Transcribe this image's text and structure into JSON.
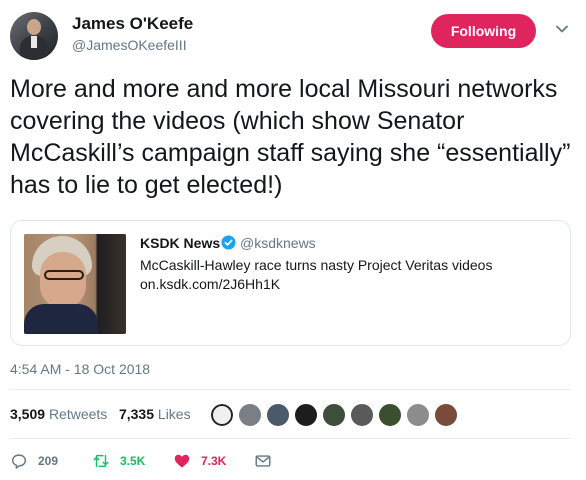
{
  "author": {
    "name": "James O'Keefe",
    "handle": "@JamesOKeefeIII",
    "follow_label": "Following"
  },
  "tweet": {
    "text": "More and more and more local Missouri networks covering the videos (which show Senator McCaskill’s campaign staff saying she “essentially” has to lie to get elected!)",
    "timestamp": "4:54 AM - 18 Oct 2018"
  },
  "card": {
    "source_name": "KSDK News",
    "source_handle": "@ksdknews",
    "title": "McCaskill-Hawley race turns nasty Project Veritas videos",
    "link": "on.ksdk.com/2J6Hh1K"
  },
  "stats": {
    "retweets_count": "3,509",
    "retweets_label": "Retweets",
    "likes_count": "7,335",
    "likes_label": "Likes"
  },
  "actions": {
    "reply_count": "209",
    "retweet_count": "3.5K",
    "like_count": "7.3K"
  },
  "colors": {
    "accent": "#e0245e",
    "verified": "#1da1f2",
    "retweet": "#17bf63",
    "muted": "#657786"
  },
  "icons": {
    "header": [
      "chevron-down-icon"
    ],
    "card": [
      "verified-badge-icon"
    ],
    "actions": [
      "reply-icon",
      "retweet-icon",
      "heart-icon",
      "message-icon"
    ]
  }
}
